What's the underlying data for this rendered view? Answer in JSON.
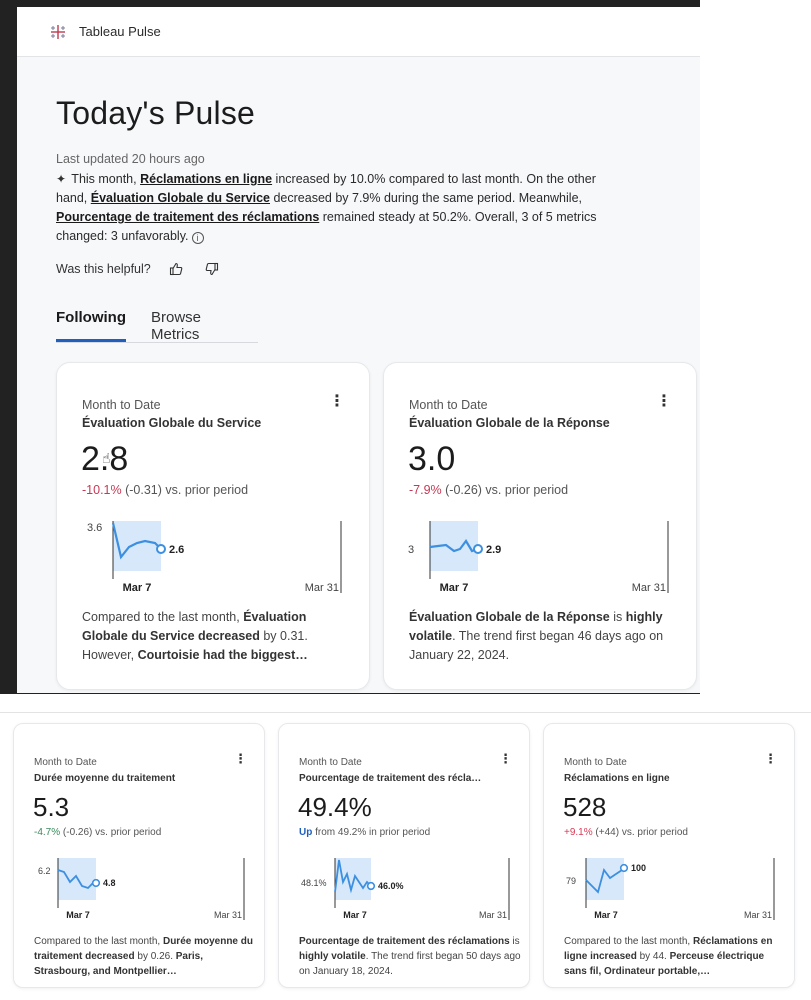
{
  "app": {
    "title": "Tableau Pulse"
  },
  "hero": {
    "heading": "Today's Pulse",
    "last_updated": "Last updated 20 hours ago",
    "s1": " This month, ",
    "h1": "Réclamations en ligne",
    "s2": " increased by 10.0% compared to last month. On the other hand, ",
    "h2": "Évaluation Globale du Service",
    "s3": " decreased by 7.9% during the same period. Meanwhile, ",
    "h3": "Pourcentage de traitement des réclamations",
    "s4": " remained steady at 50.2%. Overall, 3 of 5 metrics changed: 3 unfavorably.",
    "helpful": "Was this helpful?"
  },
  "tabs": {
    "following": "Following",
    "browse": "Browse Metrics"
  },
  "cards": [
    {
      "period": "Month to Date",
      "name": "Évaluation Globale du Service",
      "value": "2.8",
      "pct": "-10.1%",
      "change": " (-0.31) vs. prior period",
      "start_label": "3.6",
      "end_label": "2.6",
      "x_start": "Mar 7",
      "x_end": "Mar 31",
      "desc_a": "Compared to the last month, ",
      "desc_b": "Évaluation Globale du Service decreased",
      "desc_c": " by 0.31. However, ",
      "desc_d": "Courtoisie had the biggest…"
    },
    {
      "period": "Month to Date",
      "name": "Évaluation Globale de la Réponse",
      "value": "3.0",
      "pct": "-7.9%",
      "change": " (-0.26) vs. prior period",
      "start_label": "3",
      "end_label": "2.9",
      "x_start": "Mar 7",
      "x_end": "Mar 31",
      "desc_a": "Évaluation Globale de la Réponse",
      "desc_b": " is ",
      "desc_c": "highly volatile",
      "desc_d": ". The trend first began 46 days ago on January 22, 2024."
    },
    {
      "period": "Month to Date",
      "name": "Durée moyenne du traitement",
      "value": "5.3",
      "pct": "-4.7%",
      "change": " (-0.26) vs. prior period",
      "start_label": "6.2",
      "end_label": "4.8",
      "x_start": "Mar 7",
      "x_end": "Mar 31",
      "desc_a": "Compared to the last month, ",
      "desc_b": "Durée moyenne du traitement decreased",
      "desc_c": " by 0.26. ",
      "desc_d": "Paris, Strasbourg, and Montpellier…"
    },
    {
      "period": "Month to Date",
      "name": "Pourcentage de traitement des récla…",
      "value": "49.4%",
      "pct": "Up",
      "change": " from 49.2% in prior period",
      "start_label": "48.1%",
      "end_label": "46.0%",
      "x_start": "Mar 7",
      "x_end": "Mar 31",
      "desc_a": "Pourcentage de traitement des réclamations",
      "desc_b": " is ",
      "desc_c": "highly volatile",
      "desc_d": ". The trend first began 50 days ago on January 18, 2024."
    },
    {
      "period": "Month to Date",
      "name": "Réclamations en ligne",
      "value": "528",
      "pct": "+9.1%",
      "change": " (+44) vs. prior period",
      "start_label": "79",
      "end_label": "100",
      "x_start": "Mar 7",
      "x_end": "Mar 31",
      "desc_a": "Compared to the last month, ",
      "desc_b": "Réclamations en ligne increased",
      "desc_c": " by 44. ",
      "desc_d": "Perceuse électrique sans fil, Ordinateur portable,…"
    }
  ],
  "icons": {
    "logo": "tableau-logo-icon",
    "sparkle": "sparkle-icon",
    "info": "info-icon",
    "thumbs_up": "thumbs-up-icon",
    "thumbs_down": "thumbs-down-icon",
    "kebab": "more-vertical-icon"
  },
  "colors": {
    "accent": "#1f5fbf",
    "negative": "#c63955",
    "positive": "#3a8a5e",
    "spark_line": "#3d8fe0",
    "spark_fill": "#d6e8fa"
  }
}
